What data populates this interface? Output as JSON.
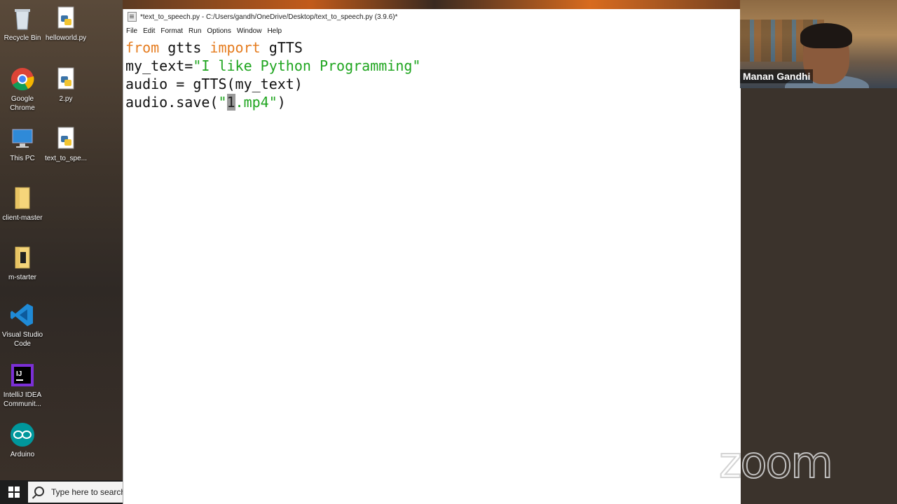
{
  "desktop": {
    "icons": [
      {
        "label": "Recycle Bin",
        "icon": "recycle-bin-icon"
      },
      {
        "label": "helloworld.py",
        "icon": "python-file-icon"
      },
      {
        "label": "Google Chrome",
        "icon": "chrome-icon"
      },
      {
        "label": "2.py",
        "icon": "python-file-icon"
      },
      {
        "label": "This PC",
        "icon": "computer-icon"
      },
      {
        "label": "text_to_spe...",
        "icon": "python-file-icon"
      },
      {
        "label": "client-master",
        "icon": "folder-icon"
      },
      {
        "label": "m-starter",
        "icon": "folder-icon"
      },
      {
        "label": "Visual Studio Code",
        "icon": "vscode-icon"
      },
      {
        "label": "IntelliJ IDEA Communit...",
        "icon": "intellij-icon"
      },
      {
        "label": "Arduino",
        "icon": "arduino-icon"
      }
    ]
  },
  "taskbar": {
    "search_placeholder": "Type here to search"
  },
  "window": {
    "title": "*text_to_speech.py - C:/Users/gandh/OneDrive/Desktop/text_to_speech.py (3.9.6)*",
    "menus": [
      "File",
      "Edit",
      "Format",
      "Run",
      "Options",
      "Window",
      "Help"
    ]
  },
  "code": {
    "line1": {
      "kw1": "from",
      "mod": " gtts ",
      "kw2": "import",
      "name": " gTTS"
    },
    "line2": {
      "lhs": "my_text=",
      "str": "\"I like Python Programming\""
    },
    "line3": {
      "text": "audio = gTTS(my_text)"
    },
    "line4": {
      "pre": "audio.save(",
      "q1": "\"",
      "sel": "1",
      "rest": ".mp4\"",
      "post": ")"
    }
  },
  "webcam": {
    "participant_name": "Manan Gandhi"
  },
  "watermark": "zoom",
  "colors": {
    "keyword": "#e57c1f",
    "string": "#1fa51f"
  }
}
